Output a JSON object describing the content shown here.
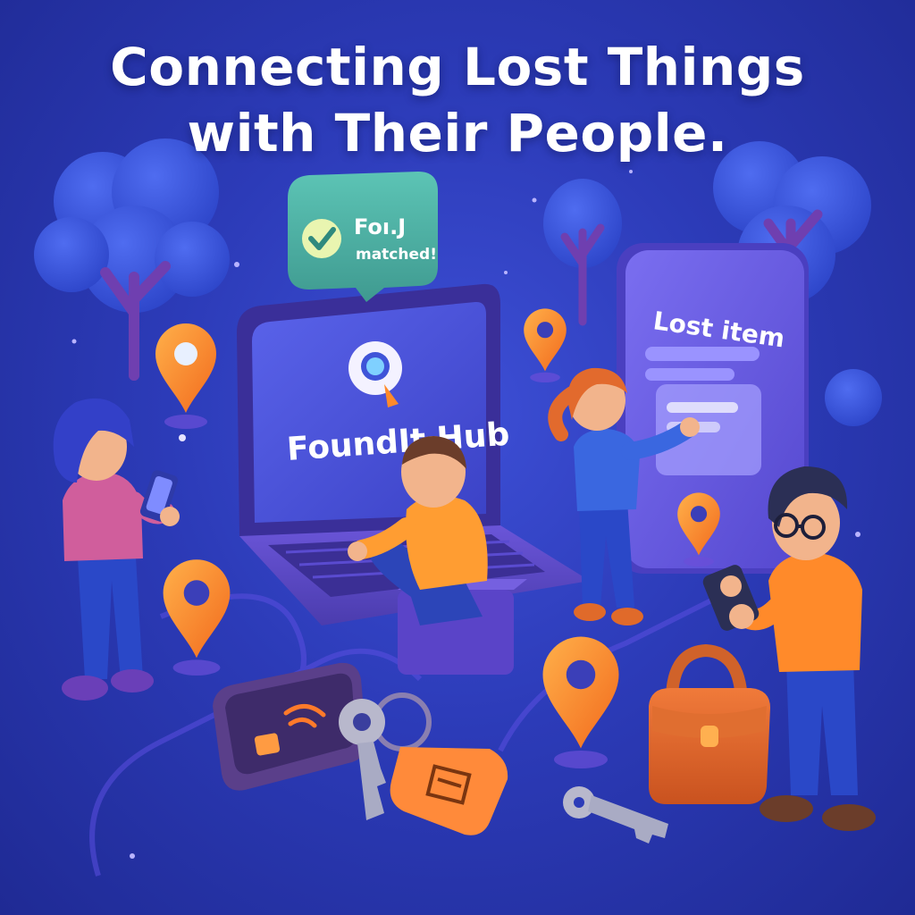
{
  "headline": {
    "line1": "Connecting Lost Things",
    "line2": "with Their People."
  },
  "match_bubble": {
    "title": "Foı.J",
    "subtitle": "matched!",
    "icon": "check-icon"
  },
  "laptop": {
    "brand": "FoundIt Hub",
    "icon": "magnifier-pin-icon"
  },
  "tablet": {
    "heading": "Lost item"
  },
  "colors": {
    "background": "#2c3bb8",
    "accent_orange": "#ff8a2a",
    "bubble_teal": "#4fb3a6",
    "screen_blue": "#4a55e0"
  }
}
